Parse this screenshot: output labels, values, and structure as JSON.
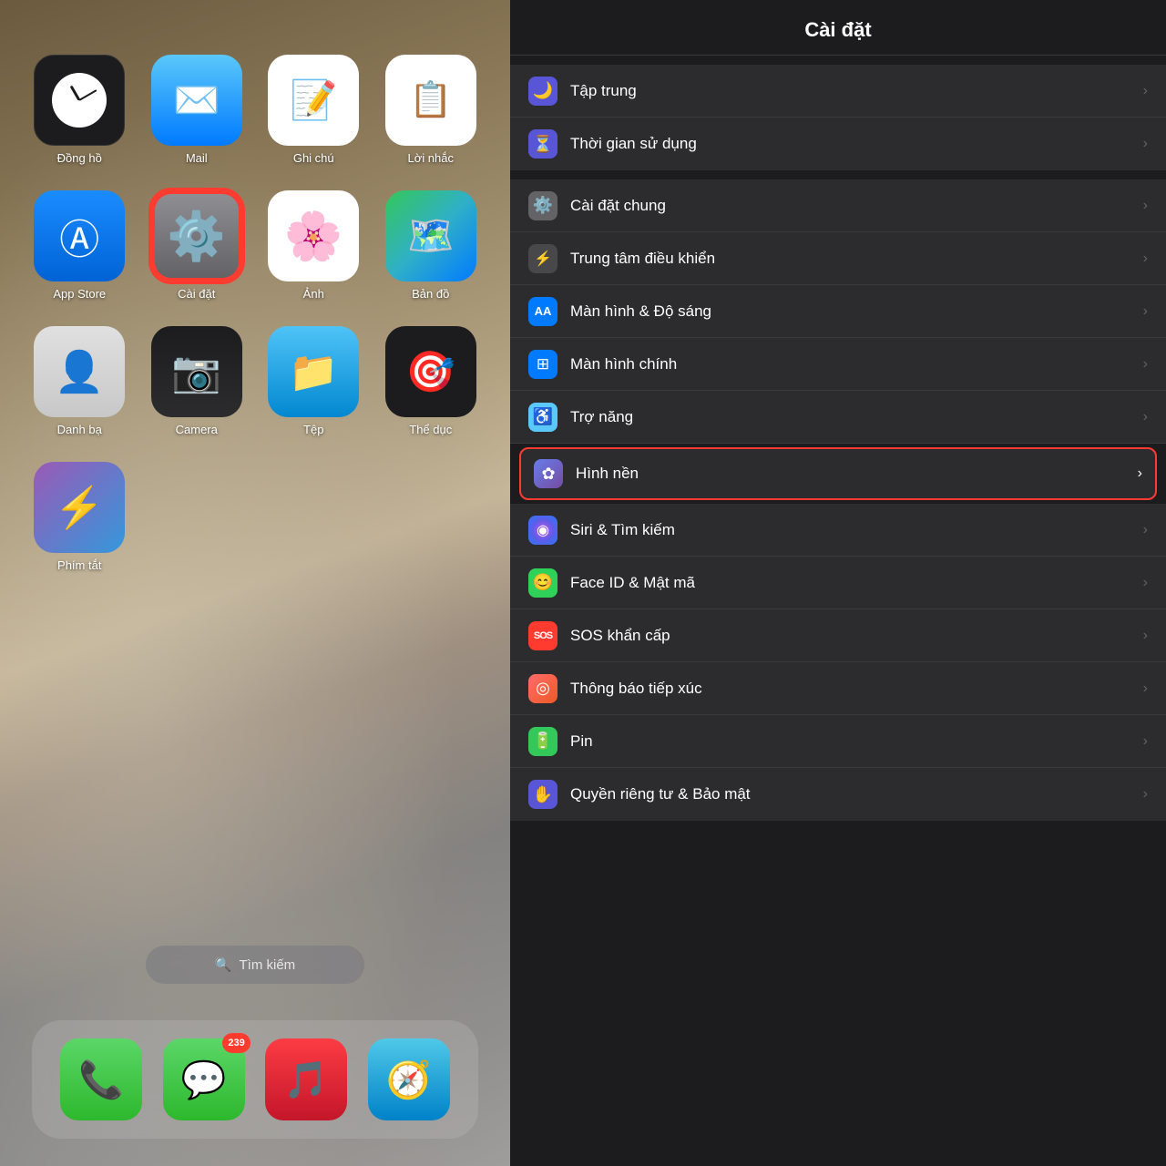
{
  "left": {
    "apps": [
      {
        "id": "clock",
        "label": "Đồng hồ",
        "icon": "clock"
      },
      {
        "id": "mail",
        "label": "Mail",
        "icon": "mail"
      },
      {
        "id": "notes",
        "label": "Ghi chú",
        "icon": "notes"
      },
      {
        "id": "reminders",
        "label": "Lời nhắc",
        "icon": "reminders"
      },
      {
        "id": "appstore",
        "label": "App Store",
        "icon": "appstore"
      },
      {
        "id": "settings",
        "label": "Cài đặt",
        "icon": "settings",
        "highlighted": true
      },
      {
        "id": "photos",
        "label": "Ảnh",
        "icon": "photos"
      },
      {
        "id": "maps",
        "label": "Bản đồ",
        "icon": "maps"
      },
      {
        "id": "contacts",
        "label": "Danh bạ",
        "icon": "contacts"
      },
      {
        "id": "camera",
        "label": "Camera",
        "icon": "camera"
      },
      {
        "id": "files",
        "label": "Tệp",
        "icon": "files"
      },
      {
        "id": "fitness",
        "label": "Thể dục",
        "icon": "fitness"
      },
      {
        "id": "shortcuts",
        "label": "Phím tắt",
        "icon": "shortcuts"
      }
    ],
    "search": {
      "placeholder": "🔍 Tìm kiếm"
    },
    "dock": [
      {
        "id": "phone",
        "label": "Phone",
        "icon": "phone"
      },
      {
        "id": "messages",
        "label": "Messages",
        "icon": "messages",
        "badge": "239"
      },
      {
        "id": "music",
        "label": "Music",
        "icon": "music"
      },
      {
        "id": "safari",
        "label": "Safari",
        "icon": "safari"
      }
    ]
  },
  "right": {
    "title": "Cài đặt",
    "partial_item": {
      "label": "",
      "icon": "pink"
    },
    "groups": [
      {
        "items": [
          {
            "id": "focus",
            "label": "Tập trung",
            "icon": "moon",
            "color": "purple"
          },
          {
            "id": "screentime",
            "label": "Thời gian sử dụng",
            "icon": "hourglass",
            "color": "purple"
          }
        ]
      },
      {
        "items": [
          {
            "id": "general",
            "label": "Cài đặt chung",
            "icon": "gear",
            "color": "gray"
          },
          {
            "id": "controlcenter",
            "label": "Trung tâm điều khiển",
            "icon": "switch",
            "color": "darkgray"
          },
          {
            "id": "display",
            "label": "Màn hình & Độ sáng",
            "icon": "AA",
            "color": "blue"
          },
          {
            "id": "homescreen",
            "label": "Màn hình chính",
            "icon": "grid",
            "color": "blue"
          },
          {
            "id": "accessibility",
            "label": "Trợ năng",
            "icon": "person-circle",
            "color": "lightblue"
          },
          {
            "id": "wallpaper",
            "label": "Hình nền",
            "icon": "flower",
            "color": "wallpaper",
            "highlighted": true
          },
          {
            "id": "siri",
            "label": "Siri & Tìm kiếm",
            "icon": "siri",
            "color": "siri"
          },
          {
            "id": "faceid",
            "label": "Face ID & Mật mã",
            "icon": "face",
            "color": "faceid"
          },
          {
            "id": "sos",
            "label": "SOS khẩn cấp",
            "icon": "SOS",
            "color": "sos"
          },
          {
            "id": "contact",
            "label": "Thông báo tiếp xúc",
            "icon": "dot-circle",
            "color": "contact"
          },
          {
            "id": "battery",
            "label": "Pin",
            "icon": "battery",
            "color": "battery"
          },
          {
            "id": "privacy",
            "label": "Quyền riêng tư & Bảo mật",
            "icon": "hand",
            "color": "privacy"
          }
        ]
      }
    ]
  }
}
